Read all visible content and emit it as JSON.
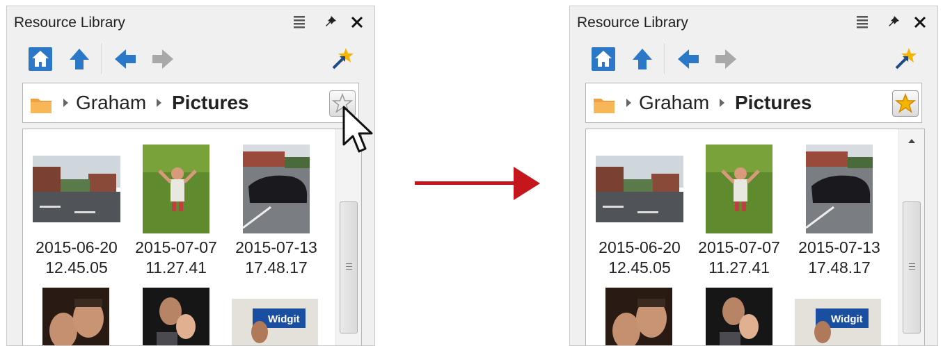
{
  "panel_title": "Resource Library",
  "breadcrumb": {
    "root": "Graham",
    "current": "Pictures"
  },
  "panels": [
    {
      "state": "before",
      "favorite": false,
      "scrollbar_up_arrow": false
    },
    {
      "state": "after",
      "favorite": true,
      "scrollbar_up_arrow": true
    }
  ],
  "thumbnails": [
    {
      "date": "2015-06-20",
      "time": "12.45.05",
      "kind": "street"
    },
    {
      "date": "2015-07-07",
      "time": "11.27.41",
      "kind": "child-grass"
    },
    {
      "date": "2015-07-13",
      "time": "17.48.17",
      "kind": "car"
    },
    {
      "date": "",
      "time": "",
      "kind": "selfie"
    },
    {
      "date": "",
      "time": "",
      "kind": "parent-child"
    },
    {
      "date": "",
      "time": "",
      "kind": "widgit-sign"
    }
  ],
  "icons": {
    "menu": "list-menu-icon",
    "pin": "pin-icon",
    "close": "close-icon",
    "home": "home-icon",
    "up": "up-arrow-icon",
    "back": "back-arrow-icon",
    "forward": "forward-arrow-icon",
    "add_favorite": "favorite-wand-icon",
    "folder": "folder-icon",
    "star": "star-icon"
  },
  "colors": {
    "toolbar_blue": "#2b78c8",
    "star_gold": "#f5b400",
    "arrow_red": "#c4161c",
    "panel_bg": "#f0f0f0"
  }
}
